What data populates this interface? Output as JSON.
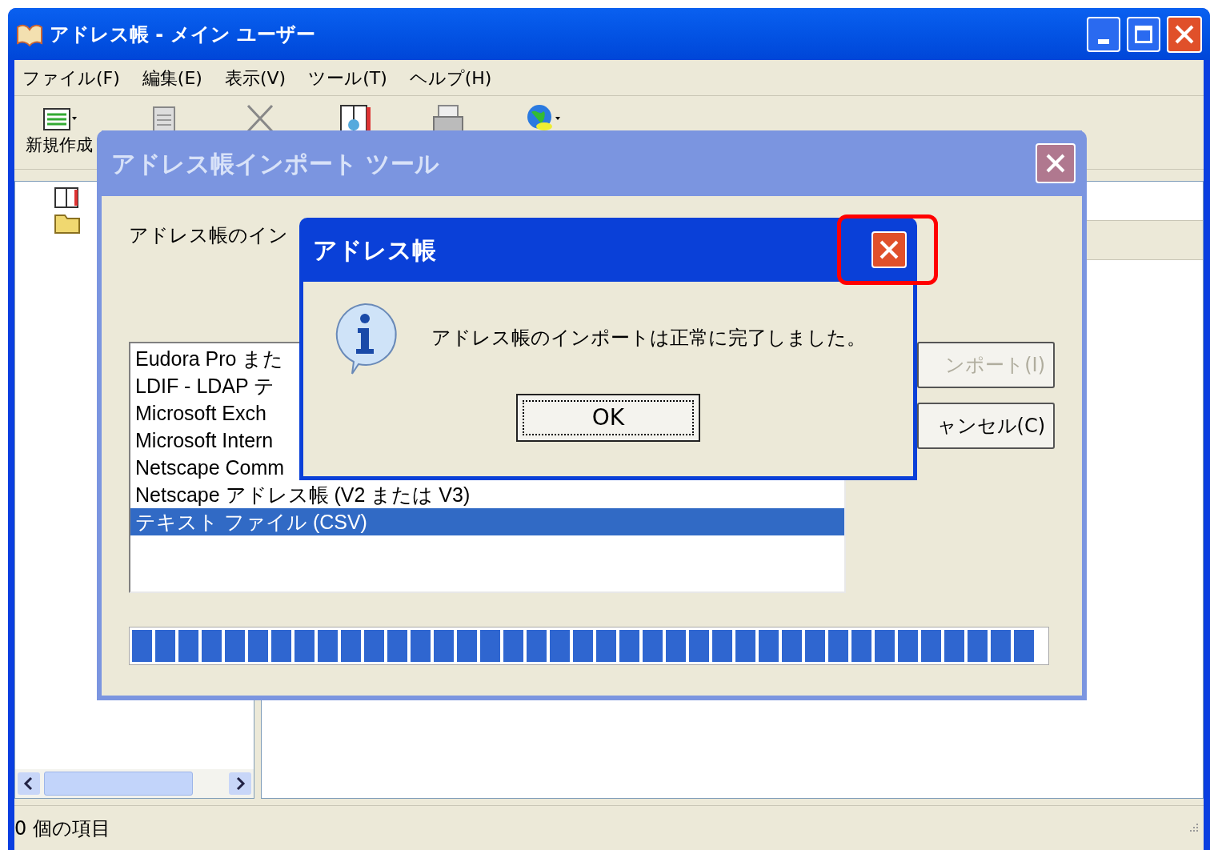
{
  "main_window": {
    "title": "アドレス帳 - メイン ユーザー",
    "menu": [
      "ファイル(F)",
      "編集(E)",
      "表示(V)",
      "ツール(T)",
      "ヘルプ(H)"
    ],
    "toolbar_label": "新規作成",
    "status_bar": "0 個の項目"
  },
  "import_dialog": {
    "title": "アドレス帳インポート ツール",
    "active": false,
    "instruction": "アドレス帳のイン",
    "formats": [
      {
        "label": "Eudora Pro また",
        "selected": false
      },
      {
        "label": "LDIF - LDAP テ",
        "selected": false
      },
      {
        "label": "Microsoft Exch",
        "selected": false
      },
      {
        "label": "Microsoft Intern",
        "selected": false
      },
      {
        "label": "Netscape Comm",
        "selected": false
      },
      {
        "label": "Netscape アドレス帳 (V2 または V3)",
        "selected": false
      },
      {
        "label": "テキスト ファイル (CSV)",
        "selected": true
      }
    ],
    "buttons": [
      {
        "label": "ンポート(I)",
        "disabled": true
      },
      {
        "label": "ャンセル(C)",
        "disabled": false
      }
    ],
    "progress": {
      "level": 1
    }
  },
  "alert": {
    "title": "アドレス帳",
    "message": "アドレス帳のインポートは正常に完了しました。",
    "ok": "OK",
    "close_highlighted": true
  }
}
